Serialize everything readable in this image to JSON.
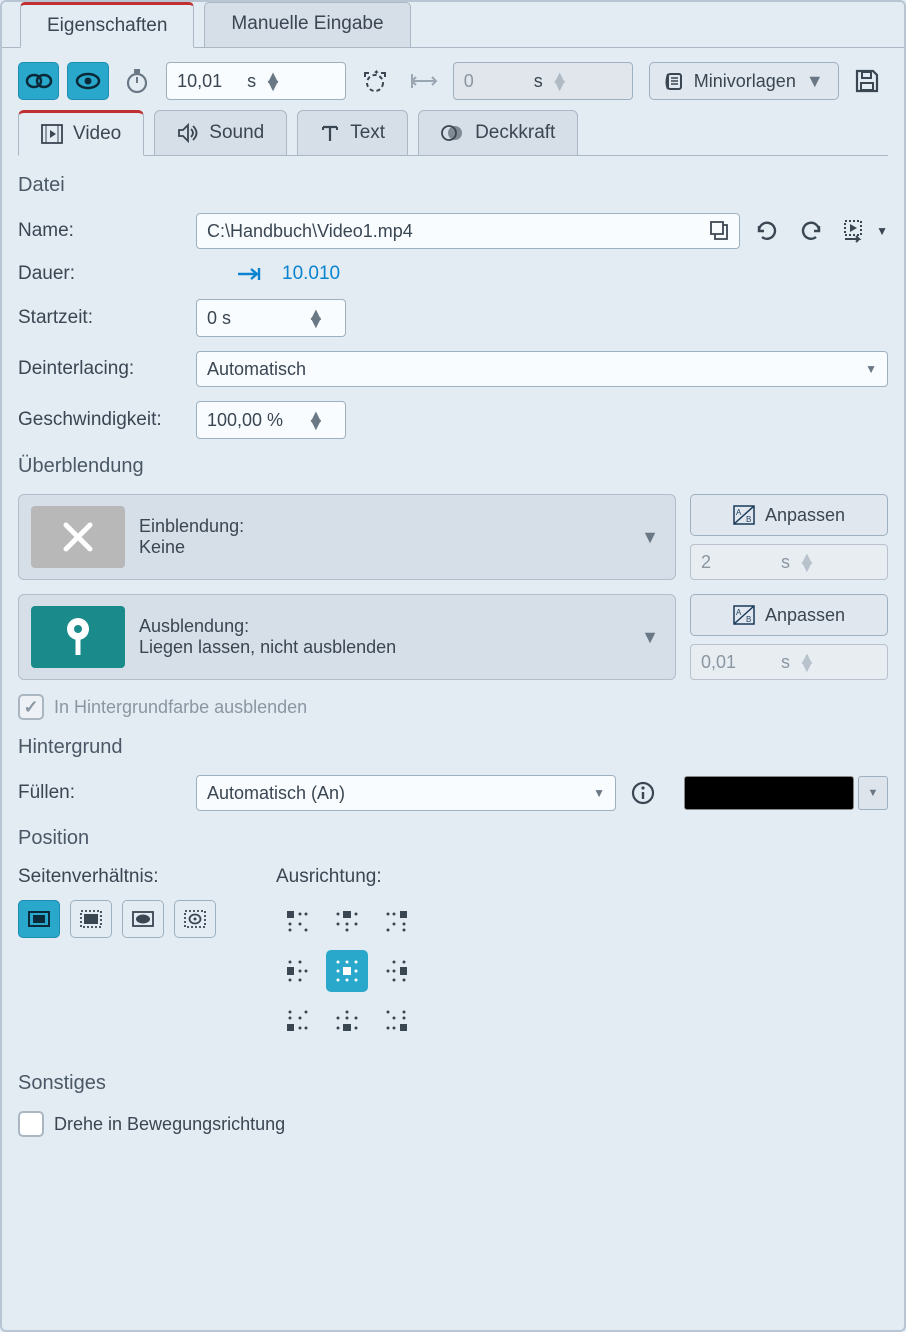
{
  "topTabs": {
    "properties": "Eigenschaften",
    "manual": "Manuelle Eingabe"
  },
  "toolbar": {
    "duration_value": "10,01",
    "duration_unit": "s",
    "offset_value": "0",
    "offset_unit": "s",
    "templates_label": "Minivorlagen"
  },
  "subTabs": {
    "video": "Video",
    "sound": "Sound",
    "text": "Text",
    "opacity": "Deckkraft"
  },
  "sections": {
    "file": "Datei",
    "transition": "Überblendung",
    "background": "Hintergrund",
    "position": "Position",
    "misc": "Sonstiges"
  },
  "file": {
    "name_label": "Name:",
    "name_value": "C:\\Handbuch\\Video1.mp4",
    "duration_label": "Dauer:",
    "duration_value": "10.010",
    "start_label": "Startzeit:",
    "start_value": "0 s",
    "deinterlace_label": "Deinterlacing:",
    "deinterlace_value": "Automatisch",
    "speed_label": "Geschwindigkeit:",
    "speed_value": "100,00 %"
  },
  "transition": {
    "in_label": "Einblendung:",
    "in_value": "Keine",
    "in_time": "2",
    "in_unit": "s",
    "out_label": "Ausblendung:",
    "out_value": "Liegen lassen, nicht ausblenden",
    "out_time": "0,01",
    "out_unit": "s",
    "adjust_label": "Anpassen",
    "fade_bg_label": "In Hintergrundfarbe ausblenden"
  },
  "background": {
    "fill_label": "Füllen:",
    "fill_value": "Automatisch (An)",
    "color": "#000000"
  },
  "position": {
    "aspect_label": "Seitenverhältnis:",
    "align_label": "Ausrichtung:"
  },
  "misc": {
    "rotate_label": "Drehe in Bewegungsrichtung"
  }
}
